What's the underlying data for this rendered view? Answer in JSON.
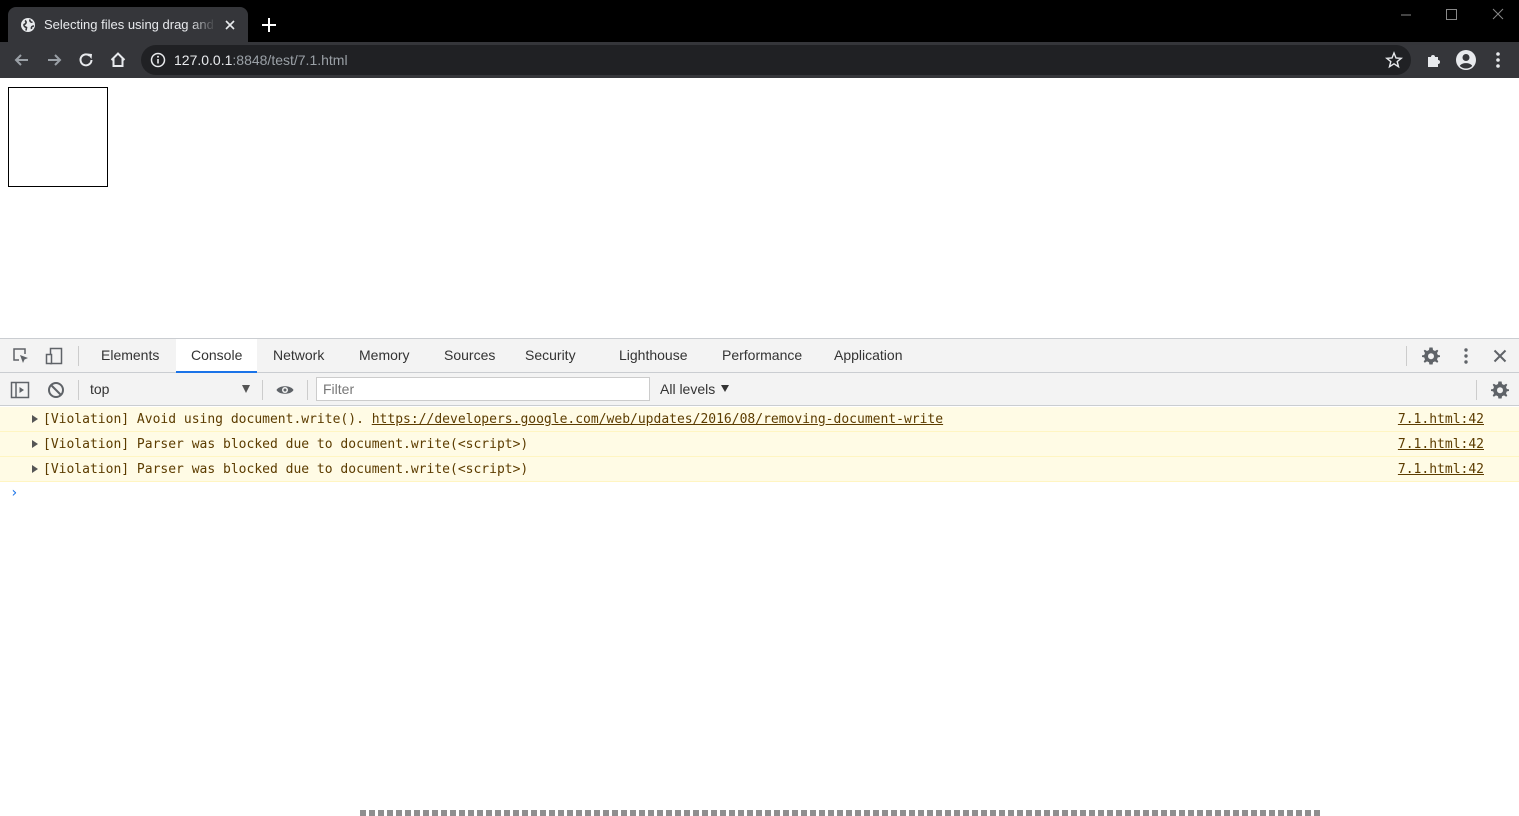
{
  "browser": {
    "tab": {
      "title": "Selecting files using drag and drop"
    },
    "address": {
      "host": "127.0.0.1",
      "rest": ":8848/test/7.1.html"
    }
  },
  "devtools": {
    "tabs": [
      {
        "label": "Elements"
      },
      {
        "label": "Console"
      },
      {
        "label": "Network"
      },
      {
        "label": "Memory"
      },
      {
        "label": "Sources"
      },
      {
        "label": "Security"
      },
      {
        "label": "Lighthouse"
      },
      {
        "label": "Performance"
      },
      {
        "label": "Application"
      }
    ],
    "active_tab": "Console",
    "console": {
      "context": "top",
      "filter_placeholder": "Filter",
      "levels": "All levels",
      "messages": [
        {
          "text": "[Violation] Avoid using document.write().",
          "link": "https://developers.google.com/web/updates/2016/08/removing-document-write",
          "source": "7.1.html:42"
        },
        {
          "text": "[Violation] Parser was blocked due to document.write(<script>)",
          "link": "",
          "source": "7.1.html:42"
        },
        {
          "text": "[Violation] Parser was blocked due to document.write(<script>)",
          "link": "",
          "source": "7.1.html:42"
        }
      ]
    }
  },
  "colors": {
    "chrome_dark": "#35363a",
    "titlebar": "#000000",
    "accent": "#1a73e8",
    "warning_bg": "#fffbe5",
    "warning_text": "#5c3c00"
  }
}
